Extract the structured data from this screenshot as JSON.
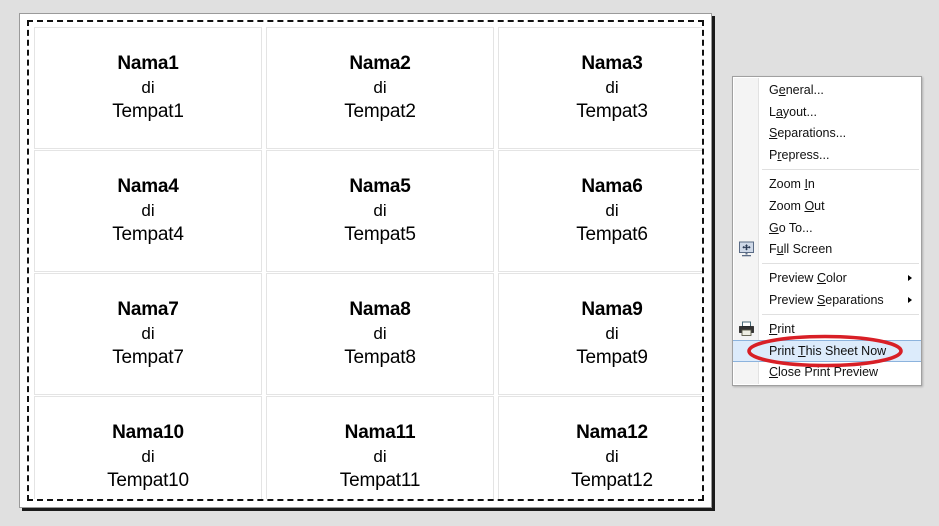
{
  "preview": {
    "page_label": "print-preview-page",
    "cards": [
      {
        "name": "Nama1",
        "sep": "di",
        "place": "Tempat1"
      },
      {
        "name": "Nama2",
        "sep": "di",
        "place": "Tempat2"
      },
      {
        "name": "Nama3",
        "sep": "di",
        "place": "Tempat3"
      },
      {
        "name": "Nama4",
        "sep": "di",
        "place": "Tempat4"
      },
      {
        "name": "Nama5",
        "sep": "di",
        "place": "Tempat5"
      },
      {
        "name": "Nama6",
        "sep": "di",
        "place": "Tempat6"
      },
      {
        "name": "Nama7",
        "sep": "di",
        "place": "Tempat7"
      },
      {
        "name": "Nama8",
        "sep": "di",
        "place": "Tempat8"
      },
      {
        "name": "Nama9",
        "sep": "di",
        "place": "Tempat9"
      },
      {
        "name": "Nama10",
        "sep": "di",
        "place": "Tempat10"
      },
      {
        "name": "Nama11",
        "sep": "di",
        "place": "Tempat11"
      },
      {
        "name": "Nama12",
        "sep": "di",
        "place": "Tempat12"
      }
    ]
  },
  "context_menu": {
    "items": [
      {
        "label": "General...",
        "accel": "e",
        "icon": null,
        "submenu": false,
        "selected": false
      },
      {
        "label": "Layout...",
        "accel": "a",
        "icon": null,
        "submenu": false,
        "selected": false
      },
      {
        "label": "Separations...",
        "accel": "S",
        "icon": null,
        "submenu": false,
        "selected": false
      },
      {
        "label": "Prepress...",
        "accel": "r",
        "icon": null,
        "submenu": false,
        "selected": false
      },
      {
        "label": "Zoom In",
        "accel": "I",
        "icon": null,
        "submenu": false,
        "selected": false
      },
      {
        "label": "Zoom Out",
        "accel": "O",
        "icon": null,
        "submenu": false,
        "selected": false
      },
      {
        "label": "Go To...",
        "accel": "G",
        "icon": null,
        "submenu": false,
        "selected": false
      },
      {
        "label": "Full Screen",
        "accel": "u",
        "icon": "full-screen-icon",
        "submenu": false,
        "selected": false
      },
      {
        "label": "Preview Color",
        "accel": "C",
        "icon": null,
        "submenu": true,
        "selected": false
      },
      {
        "label": "Preview Separations",
        "accel": "S",
        "icon": null,
        "submenu": true,
        "selected": false
      },
      {
        "label": "Print",
        "accel": "P",
        "icon": "printer-icon",
        "submenu": false,
        "selected": false
      },
      {
        "label": "Print This Sheet Now",
        "accel": "T",
        "icon": null,
        "submenu": false,
        "selected": true
      },
      {
        "label": "Close Print Preview",
        "accel": "C",
        "icon": null,
        "submenu": false,
        "selected": false
      }
    ],
    "separator_after_indices": [
      3,
      7,
      9
    ],
    "highlight_color": "#dcebfb",
    "highlight_border_color": "#8cb3dd"
  },
  "annotation": {
    "shape": "ellipse",
    "color": "#d81f26",
    "target_label": "Print This Sheet Now"
  }
}
